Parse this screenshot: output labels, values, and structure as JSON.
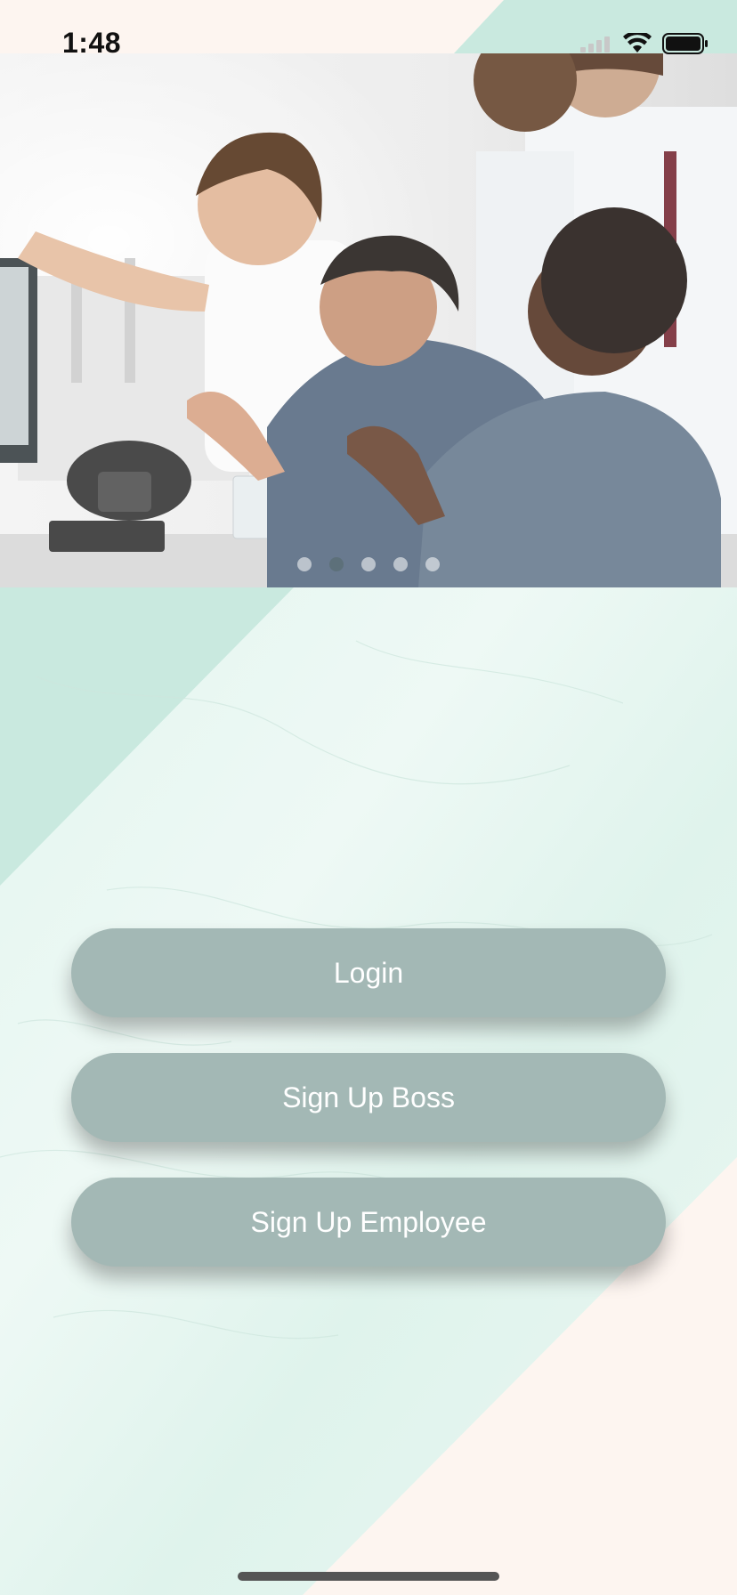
{
  "status_bar": {
    "time": "1:48"
  },
  "carousel": {
    "page_count": 5,
    "active_index": 1
  },
  "actions": {
    "login_label": "Login",
    "signup_boss_label": "Sign Up Boss",
    "signup_employee_label": "Sign Up Employee"
  },
  "colors": {
    "button_bg": "#a3b8b5",
    "mint": "#c9e9df",
    "cream": "#fdf5f0"
  }
}
